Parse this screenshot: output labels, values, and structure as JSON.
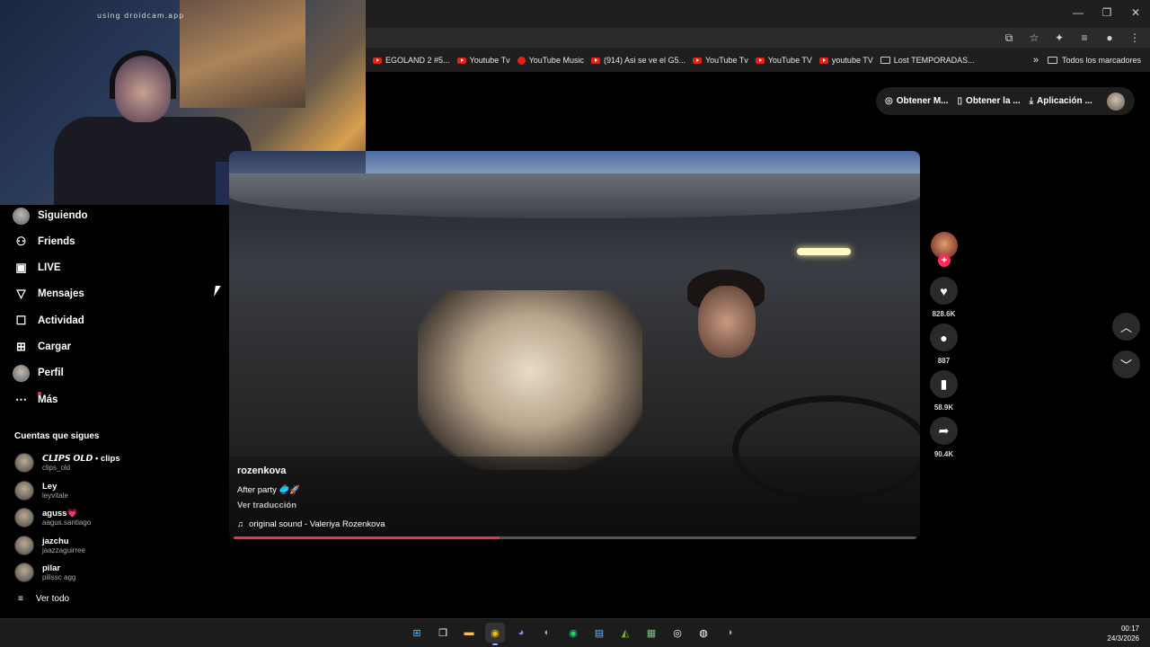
{
  "webcam": {
    "label": "using droidcam.app"
  },
  "bookmarks": {
    "items": [
      {
        "label": "EGOLAND 2 #5...",
        "icon": "youtube-icon"
      },
      {
        "label": "Youtube Tv",
        "icon": "youtube-icon"
      },
      {
        "label": "YouTube Music",
        "icon": "youtube-music-icon"
      },
      {
        "label": "(914) Asi se ve el G5...",
        "icon": "youtube-icon"
      },
      {
        "label": "YouTube Tv",
        "icon": "youtube-icon"
      },
      {
        "label": "YouTube TV",
        "icon": "youtube-icon"
      },
      {
        "label": "youtube TV",
        "icon": "youtube-icon"
      },
      {
        "label": "Lost TEMPORADAS...",
        "icon": "page-icon"
      }
    ],
    "more": "»",
    "all_label": "Todos los marcadores"
  },
  "sidebar": {
    "items": [
      {
        "label": "Siguiendo",
        "icon": "following-avatar-icon"
      },
      {
        "label": "Friends",
        "icon": "friends-icon"
      },
      {
        "label": "LIVE",
        "icon": "live-icon"
      },
      {
        "label": "Mensajes",
        "icon": "messages-icon"
      },
      {
        "label": "Actividad",
        "icon": "activity-icon"
      },
      {
        "label": "Cargar",
        "icon": "upload-icon"
      },
      {
        "label": "Perfil",
        "icon": "profile-icon"
      },
      {
        "label": "Más",
        "icon": "more-icon"
      }
    ],
    "following_title": "Cuentas que sigues",
    "accounts": [
      {
        "name": "𝘾𝙇𝙄𝙋𝙎 𝙊𝙇𝘿 • clips",
        "user": "clips_old"
      },
      {
        "name": "Ley",
        "user": "leyvitale"
      },
      {
        "name": "aguss💗",
        "user": "aagus.santiago"
      },
      {
        "name": "jazchu",
        "user": "jaazzaguirree"
      },
      {
        "name": "pilar",
        "user": "pilissc agg"
      }
    ],
    "see_all": "Ver todo"
  },
  "top_actions": {
    "get_m": "Obtener M...",
    "get_the": "Obtener la ...",
    "app": "Aplicación ..."
  },
  "video": {
    "author": "rozenkova",
    "caption": "After party 🥏🚀",
    "translate": "Ver traducción",
    "sound": "original sound - Valeriya Rozenkova",
    "progress": 0.39
  },
  "stats": {
    "likes": "828.6K",
    "comments": "887",
    "saves": "58.9K",
    "shares": "90.4K"
  },
  "clock": {
    "time": "00:17",
    "date": "24/3/2026"
  },
  "colors": {
    "accent": "#fe2c55",
    "background": "#000000",
    "panel": "#1e1e1e"
  }
}
